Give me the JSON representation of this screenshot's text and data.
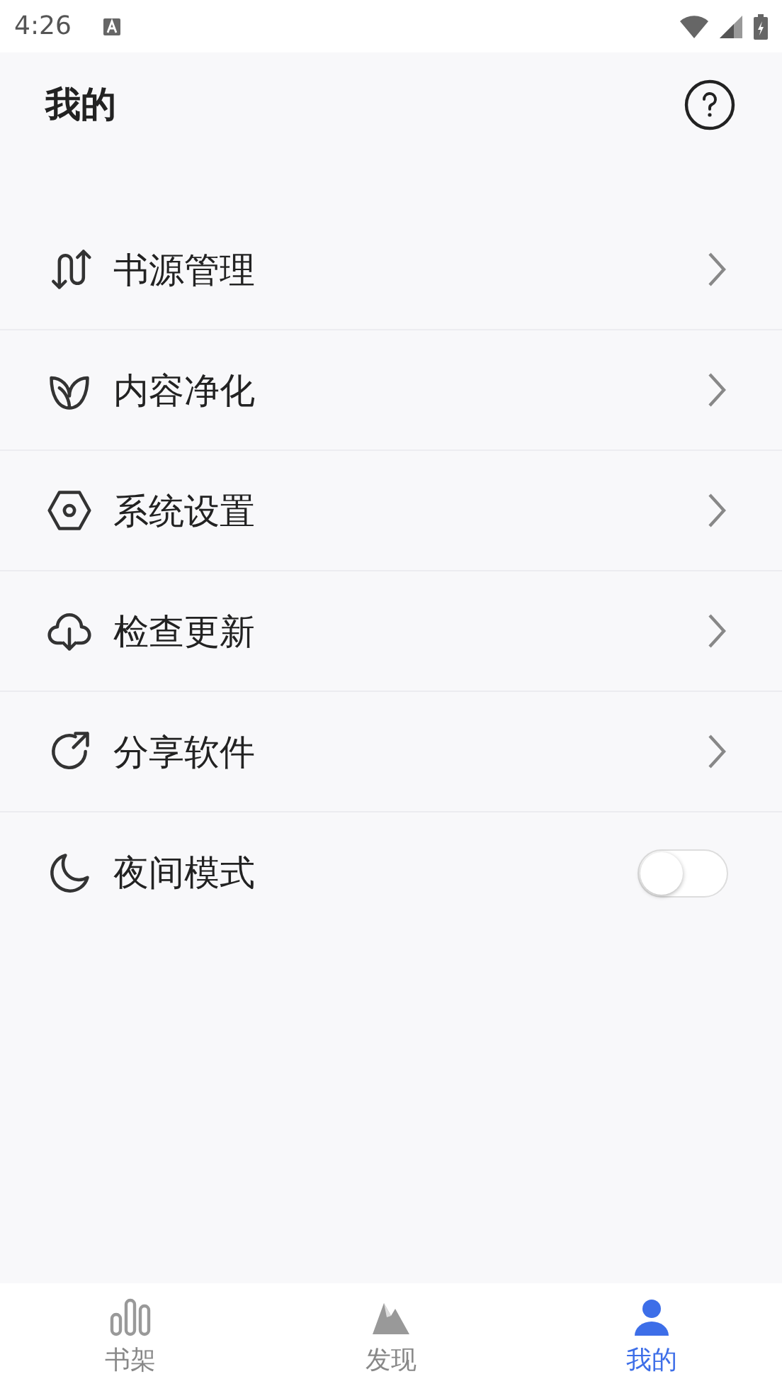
{
  "status_bar": {
    "time": "4:26"
  },
  "header": {
    "title": "我的"
  },
  "menu": [
    {
      "label": "书源管理",
      "kind": "link"
    },
    {
      "label": "内容净化",
      "kind": "link"
    },
    {
      "label": "系统设置",
      "kind": "link"
    },
    {
      "label": "检查更新",
      "kind": "link"
    },
    {
      "label": "分享软件",
      "kind": "link"
    },
    {
      "label": "夜间模式",
      "kind": "toggle",
      "on": false
    }
  ],
  "bottom_nav": [
    {
      "label": "书架",
      "selected": false
    },
    {
      "label": "发现",
      "selected": false
    },
    {
      "label": "我的",
      "selected": true
    }
  ]
}
